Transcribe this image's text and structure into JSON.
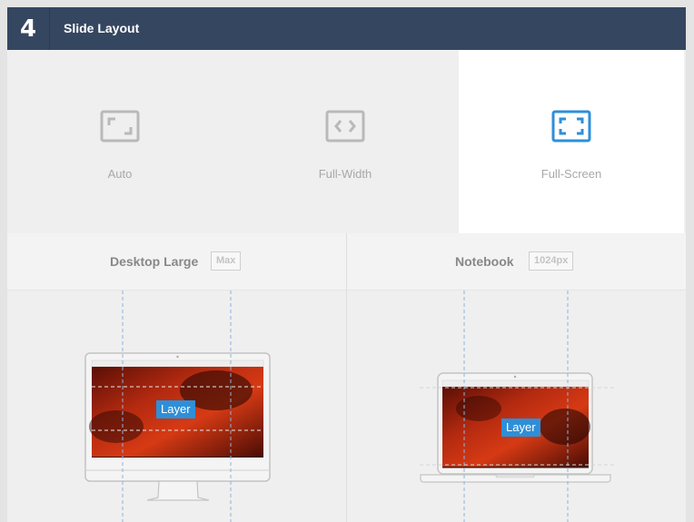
{
  "header": {
    "step": "4",
    "title": "Slide Layout"
  },
  "layout_options": [
    {
      "label": "Auto",
      "icon": "auto-layout-icon",
      "selected": false
    },
    {
      "label": "Full-Width",
      "icon": "full-width-icon",
      "selected": false
    },
    {
      "label": "Full-Screen",
      "icon": "full-screen-icon",
      "selected": true
    }
  ],
  "devices": [
    {
      "name": "Desktop Large",
      "badge": "Max",
      "layer_label": "Layer",
      "icon": "desktop-monitor-icon"
    },
    {
      "name": "Notebook",
      "badge": "1024px",
      "layer_label": "Layer",
      "icon": "laptop-icon"
    }
  ],
  "colors": {
    "header_bg": "#354760",
    "accent": "#2e8fd8",
    "inactive_icon": "#b9b9b9"
  }
}
